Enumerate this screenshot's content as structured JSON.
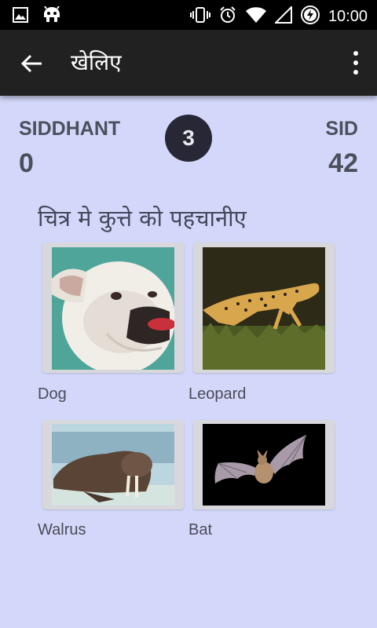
{
  "status_bar": {
    "time": "10:00",
    "icons": [
      "image-icon",
      "android-icon",
      "vibrate-icon",
      "alarm-icon",
      "wifi-icon",
      "signal-icon",
      "battery-charging-icon"
    ]
  },
  "app_bar": {
    "title": "खेलिए",
    "back_icon": "back-arrow-icon",
    "menu_icon": "overflow-menu-icon"
  },
  "scoreboard": {
    "player1": {
      "name": "SIDDHANT",
      "score": "0"
    },
    "round": "3",
    "player2": {
      "name": "SID",
      "score": "42"
    }
  },
  "question": "चित्र मे कुत्ते को पहचानीए",
  "options": [
    {
      "label": "Dog"
    },
    {
      "label": "Leopard"
    },
    {
      "label": "Walrus"
    },
    {
      "label": "Bat"
    }
  ],
  "colors": {
    "background": "#d3d7f9",
    "app_bar": "#212121",
    "round_badge": "#272735",
    "card": "#d8d8dc"
  }
}
